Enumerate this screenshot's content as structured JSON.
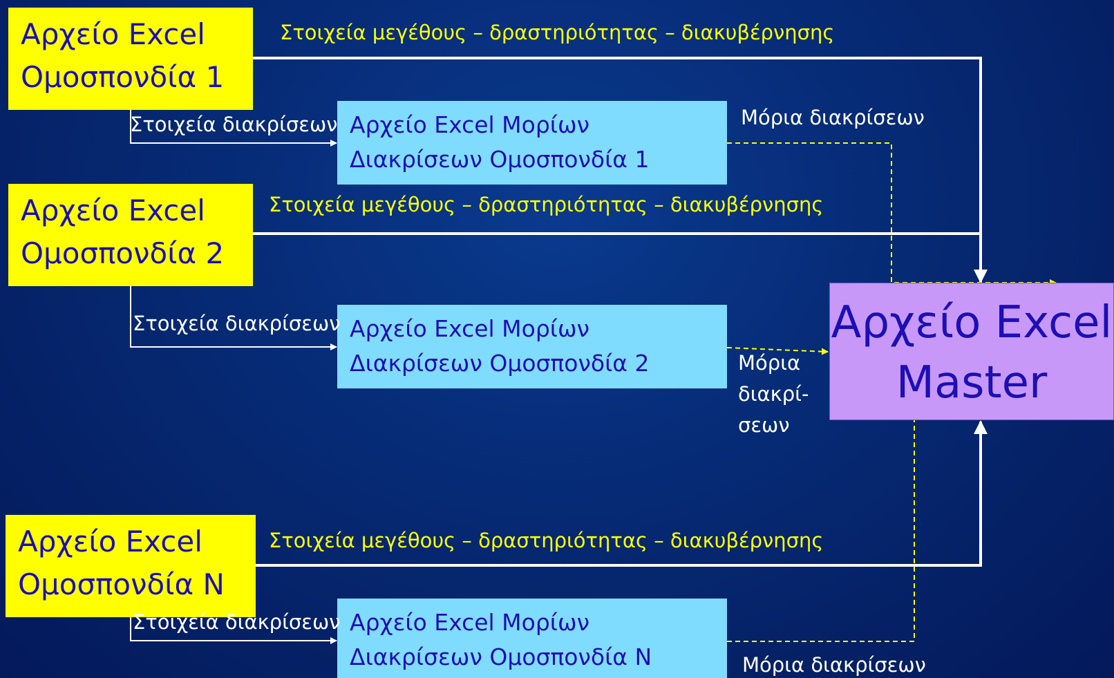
{
  "federations": [
    {
      "line1": "Αρχείο Excel",
      "line2": "Ομοσπονδία 1"
    },
    {
      "line1": "Αρχείο Excel",
      "line2": "Ομοσπονδία 2"
    },
    {
      "line1": "Αρχείο Excel",
      "line2": "Ομοσπονδία Ν"
    }
  ],
  "moria_files": [
    {
      "line1": "Αρχείο Excel Μορίων",
      "line2": "Διακρίσεων Ομοσπονδία 1"
    },
    {
      "line1": "Αρχείο Excel Μορίων",
      "line2": "Διακρίσεων Ομοσπονδία 2"
    },
    {
      "line1": "Αρχείο Excel Μορίων",
      "line2": "Διακρίσεων Ομοσπονδία Ν"
    }
  ],
  "master": {
    "line1": "Αρχείο Excel",
    "line2": "Master"
  },
  "labels": {
    "size_activity_governance": "Στοιχεία μεγέθους – δραστηριότητας – διακυβέρνησης",
    "distinction_data": "Στοιχεία διακρίσεων",
    "distinction_points": "Μόρια διακρίσεων",
    "distinction_points_split": [
      "Μόρια",
      "διακρί-",
      "σεων"
    ]
  },
  "colors": {
    "background": "#062a74",
    "federation_box": "#ffff00",
    "moria_box": "#80dcff",
    "master_box": "#c898f8",
    "box_text": "#1c0fb5",
    "solid_line": "#ffffff",
    "dashed_line": "#ffff00"
  }
}
